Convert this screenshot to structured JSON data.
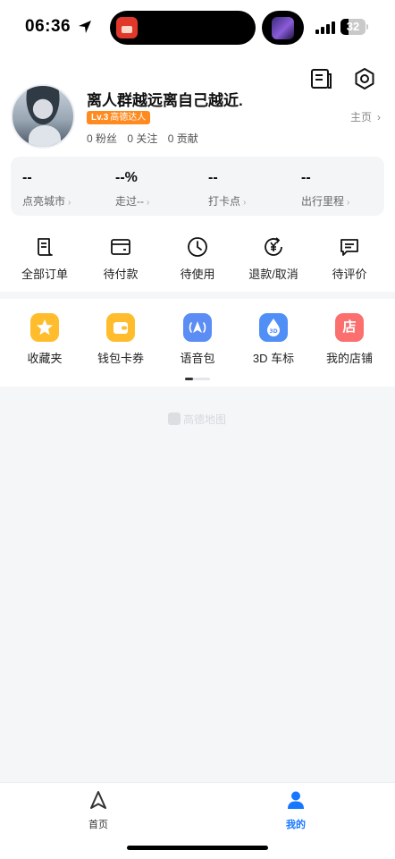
{
  "status_bar": {
    "time": "06:36",
    "battery": "32",
    "battery_level": 0.32
  },
  "header": {
    "username": "离人群越远离自己越近.",
    "level": "Lv.3",
    "level_title": "高德达人",
    "fans": "0 粉丝",
    "following": "0 关注",
    "contributions": "0 贡献",
    "homepage_link": "主页",
    "top_icons": [
      "notes-icon",
      "settings-icon"
    ]
  },
  "stats": [
    {
      "value": "--",
      "label": "点亮城市"
    },
    {
      "value": "--%",
      "label": "走过--"
    },
    {
      "value": "--",
      "label": "打卡点"
    },
    {
      "value": "--",
      "label": "出行里程"
    }
  ],
  "orders": [
    {
      "label": "全部订单",
      "icon": "order-list-icon"
    },
    {
      "label": "待付款",
      "icon": "wallet-card-icon"
    },
    {
      "label": "待使用",
      "icon": "clock-icon"
    },
    {
      "label": "退款/取消",
      "icon": "refund-yen-icon"
    },
    {
      "label": "待评价",
      "icon": "comment-icon"
    }
  ],
  "tools": [
    {
      "label": "收藏夹",
      "icon": "star-icon",
      "color": "#ffbd2e"
    },
    {
      "label": "钱包卡券",
      "icon": "wallet-icon",
      "color": "#ffbd2e"
    },
    {
      "label": "语音包",
      "icon": "voice-navigation-icon",
      "color": "#5b8df5"
    },
    {
      "label": "3D 车标",
      "icon": "3d-car-icon",
      "color": "#4f8ff6"
    },
    {
      "label": "我的店铺",
      "icon": "shop-icon",
      "color": "#fb6f6f",
      "glyph": "店"
    }
  ],
  "watermark": "高德地图",
  "tabbar": {
    "tabs": [
      {
        "label": "首页",
        "icon": "navigation-arrow-icon",
        "active": false
      },
      {
        "label": "我的",
        "icon": "person-icon",
        "active": true
      }
    ],
    "active_color": "#1677ff"
  }
}
